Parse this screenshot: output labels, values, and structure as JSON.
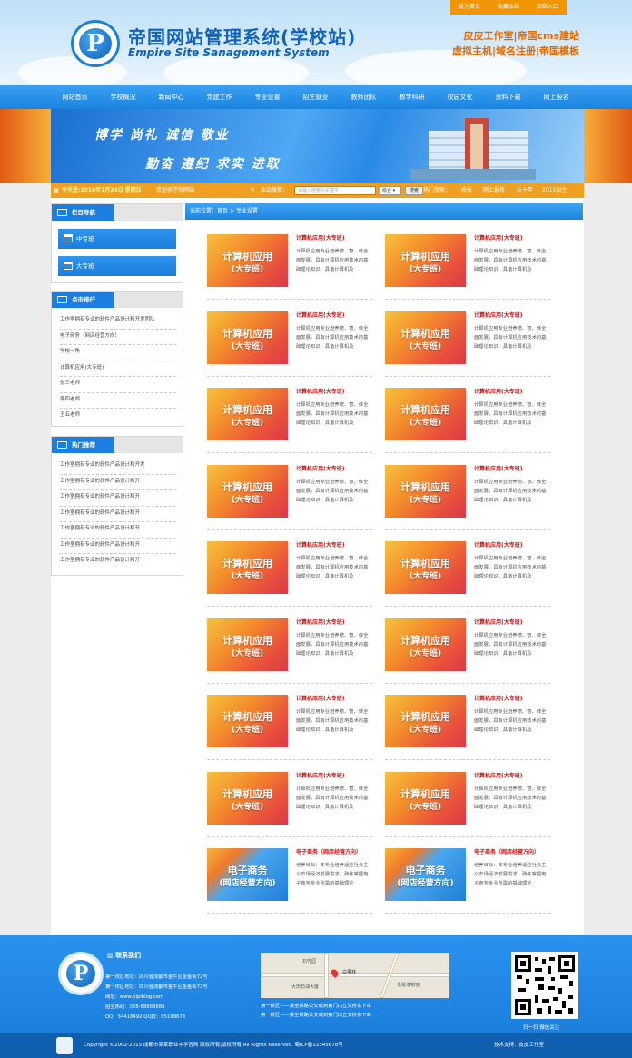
{
  "top_links": [
    "设为首页",
    "收藏本站",
    "旧站入口"
  ],
  "site": {
    "title": "帝国网站管理系统(学校站)",
    "subtitle": "Empire Site Sanagement System",
    "ad_line1": "皮皮工作室|帝国cms建站",
    "ad_line2": "虚拟主机|域名注册|帝国模板"
  },
  "nav": [
    "网站首页",
    "学校概况",
    "新闻中心",
    "党建工作",
    "专业设置",
    "招生就业",
    "教师团队",
    "教学科研",
    "校园文化",
    "资料下载",
    "网上报名"
  ],
  "banner": {
    "slogan1": "博学  尚礼  诚信  敬业",
    "slogan2": "勤奋  遵纪  求实  进取"
  },
  "infobar": {
    "date": "今天是:2016年1月24日 星期日",
    "welcome": "欢迎来学校网站",
    "search_label": "本站搜索：",
    "search_placeholder": "请输入搜索的关键字",
    "select_value": "综合",
    "search_button": "搜索",
    "hot_label": "热门搜索：",
    "hot_terms": [
      "校长",
      "网上报名",
      "五十年",
      "2015招生"
    ]
  },
  "sidebar": {
    "nav_title": "栏目导航",
    "nav_items": [
      "中专班",
      "大专班"
    ],
    "rank_title": "点击排行",
    "rank_items": [
      "工作室拥有专业的软件产品设计和开发团队",
      "电子商务（网店经营方向）",
      "学校一角",
      "计算机应用(大专班)",
      "张三老师",
      "李四老师",
      "王五老师"
    ],
    "hot_title": "热门推荐",
    "hot_items": [
      "工作室拥有专业的软件产品设计和开发",
      "工作室拥有专业的软件产品设计和开",
      "工作室拥有专业的软件产品设计和开",
      "工作室拥有专业的软件产品设计和开",
      "工作室拥有专业的软件产品设计和开",
      "工作室拥有专业的软件产品设计和开",
      "工作室拥有专业的软件产品设计和开"
    ]
  },
  "breadcrumb": "当前位置：首页 > 专业设置",
  "cards": [
    {
      "t1": "计算机应用",
      "t2": "(大专班)",
      "title": "计算机应用(大专班)",
      "desc": "计算机应用专业培养德、智、体全面发展，具有计算机应用技术的基础理论知识，具备计算机及",
      "theme": "r"
    },
    {
      "t1": "电子商务",
      "t2": "(网店经营方向)",
      "title": "电子商务（网店经营方向）",
      "desc": "培养目标：本专业培养适应社会主义市场经济发展需求，熟练掌握电子商务专业所需的基础理论",
      "theme": "b"
    }
  ],
  "footer": {
    "contact_title": "联系我们",
    "lines": [
      "第一校区地址：四川省成都市金牛区金鱼街72号",
      "第一校区地址：四川省成都市金牛区金鱼街72号",
      "网址：www.pipiblog.com",
      "招生热线：028-88888888",
      "QQ：54418492 QQ群：95168678"
    ],
    "map_labels": [
      "石竹园",
      "白果林",
      "大庆石油大厦",
      "永陵博物馆"
    ],
    "map_caption": "第一校区——乘坐乘路公交或到第门口立交桥东下车",
    "map_caption2": "第一校区——乘坐乘路公交或到第门口立交桥东下车",
    "qr_caption": "扫一扫 微信关注",
    "copyright": "Copyright ©2002-2015 成都市某某职业中学官网 版权所有|版权所有 All Rights Reserved. 蜀ICP备12345678号",
    "support": "技术支持：皮皮工作室"
  }
}
